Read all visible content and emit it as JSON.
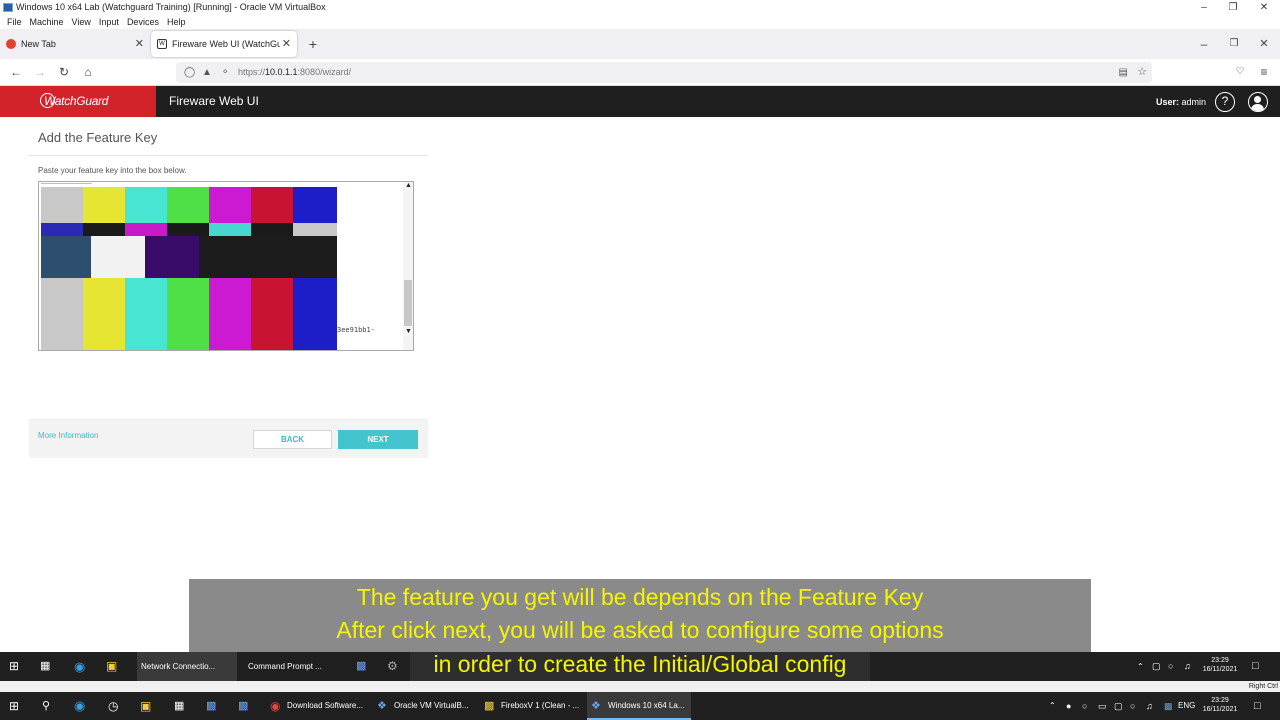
{
  "host_window": {
    "title": "Windows 10 x64  Lab (Watchguard Training) [Running] - Oracle VM VirtualBox",
    "menu": [
      "File",
      "Machine",
      "View",
      "Input",
      "Devices",
      "Help"
    ]
  },
  "browser": {
    "tabs": [
      {
        "label": "New Tab",
        "active": false
      },
      {
        "label": "Fireware Web UI (WatchGuard",
        "active": true
      }
    ],
    "url_prefix": "https://",
    "url_host": "10.0.1.1",
    "url_rest": ":8080/wizard/"
  },
  "app_header": {
    "logo": "WatchGuard",
    "app_name": "Fireware Web UI",
    "user_label": "User:",
    "user_name": "admin",
    "help_glyph": "?"
  },
  "wizard": {
    "title": "Add the Feature Key",
    "instruction": "Paste your feature key into the box below.",
    "key_visible_text": "3ee91bb1-",
    "more_info": "More Information",
    "back_label": "BACK",
    "next_label": "NEXT"
  },
  "subtitles": [
    "The feature you get will be depends on the Feature Key",
    "After click next, you will be asked to configure some options",
    "in order to create the Initial/Global config"
  ],
  "guest_taskbar": {
    "items": [
      "Network Connectio...",
      "Command Prompt ..."
    ],
    "clock_time": "23:29",
    "clock_date": "16/11/2021"
  },
  "vm_status": {
    "host_key": "Right Ctrl"
  },
  "host_taskbar": {
    "items": [
      "Download Software...",
      "Oracle VM VirtualB...",
      "FireboxV 1 (Clean - ...",
      "Windows 10 x64  La..."
    ],
    "lang": "ENG",
    "clock_time": "23:29",
    "clock_date": "16/11/2021"
  },
  "colors": {
    "watchguard_red": "#d2232a",
    "header_dark": "#1f1f1f",
    "accent_teal": "#44c4cd",
    "subtitle_yellow": "#f5f500"
  }
}
